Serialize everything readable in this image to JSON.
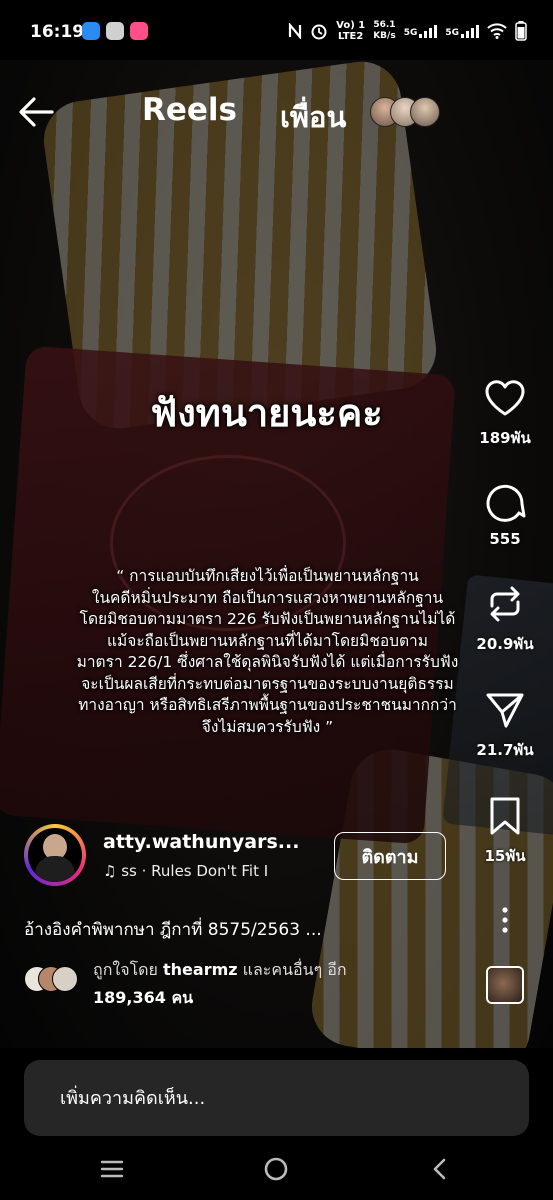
{
  "status_bar": {
    "time": "16:19",
    "network_type": "LTE2",
    "speed": "56.1",
    "speed_unit": "KB/s",
    "net1": "5G",
    "net2": "5G",
    "vol_label": "Vo) 1"
  },
  "header": {
    "title": "Reels",
    "friends_label": "เพื่อน"
  },
  "overlay": {
    "heading": "ฟังทนายนะคะ",
    "quote_lines": [
      "“ การแอบบันทึกเสียงไว้เพื่อเป็นพยานหลักฐาน",
      "ในคดีหมิ่นประมาท ถือเป็นการแสวงหาพยานหลักฐาน",
      "โดยมิชอบตามมาตรา 226 รับฟังเป็นพยานหลักฐานไม่ได้",
      "แม้จะถือเป็นพยานหลักฐานที่ได้มาโดยมิชอบตาม",
      "มาตรา 226/1 ซึ่งศาลใช้ดุลพินิจรับฟังได้ แต่เมื่อการรับฟัง",
      "จะเป็นผลเสียที่กระทบต่อมาตรฐานของระบบงานยุติธรรม",
      "ทางอาญา หรือสิทธิเสรีภาพพื้นฐานของประชาชนมากกว่า",
      "จึงไม่สมควรรับฟัง ”"
    ]
  },
  "actions": {
    "likes": "189พัน",
    "comments": "555",
    "reposts": "20.9พัน",
    "shares": "21.7พัน",
    "saves": "15พัน"
  },
  "author": {
    "username": "atty.wathunyars...",
    "music": "♫ ss · Rules Don't Fit I"
  },
  "follow_label": "ติดตาม",
  "caption": "อ้างอิงคำพิพากษา ฎีกาที่ 8575/2563 ...",
  "liked_by": {
    "prefix": "ถูกใจโดย ",
    "user": "thearmz",
    "suffix": " และคนอื่นๆ อีก",
    "count": "189,364 คน"
  },
  "comment_placeholder": "เพิ่มความคิดเห็น...",
  "colors": {
    "background": "#000000",
    "comment_bar": "#262626",
    "book_red": "#5a1a1e",
    "stripe_gold": "#c9a24a"
  }
}
